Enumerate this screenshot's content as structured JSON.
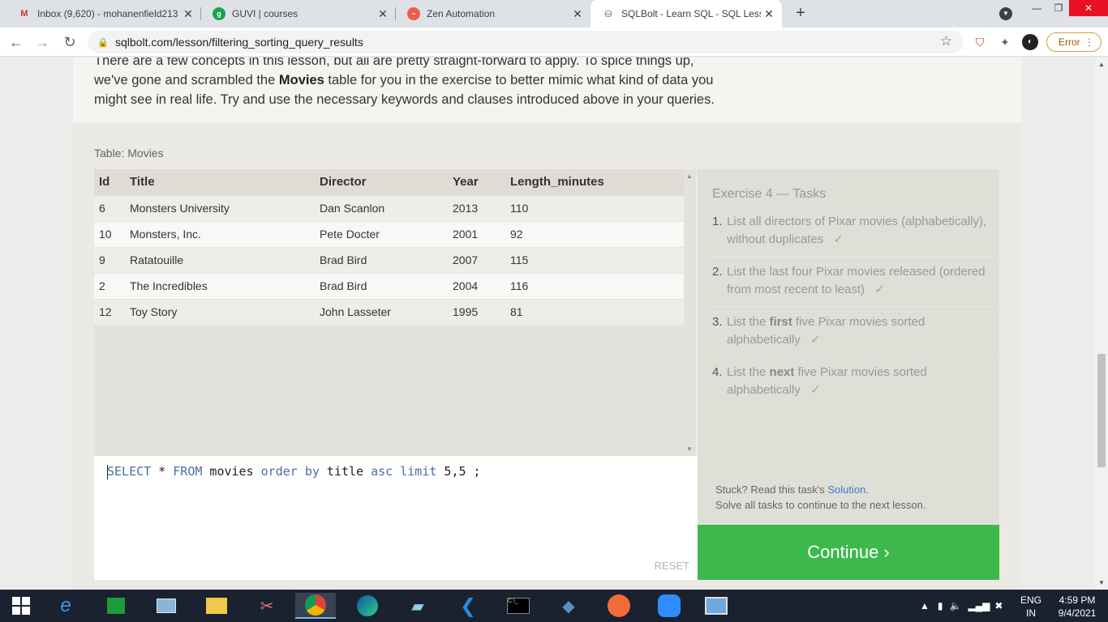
{
  "browser": {
    "tabs": [
      {
        "title": "Inbox (9,620) - mohanenfield213",
        "favicon": "gmail-icon"
      },
      {
        "title": "GUVI | courses",
        "favicon": "guvi-icon"
      },
      {
        "title": "Zen Automation",
        "favicon": "zen-icon"
      },
      {
        "title": "SQLBolt - Learn SQL - SQL Lesso",
        "favicon": "sqlbolt-icon",
        "active": true
      }
    ],
    "url": "sqlbolt.com/lesson/filtering_sorting_query_results",
    "error_label": "Error"
  },
  "lesson": {
    "intro_line1": "There are a few concepts in this lesson, but all are pretty straight-forward to apply. To spice things up,",
    "intro_line2_pre": "we've gone and scrambled the ",
    "intro_line2_bold": "Movies",
    "intro_line2_post": " table for you in the exercise to better mimic what kind of data you",
    "intro_line3": "might see in real life. Try and use the necessary keywords and clauses introduced above in your queries."
  },
  "table": {
    "label": "Table: Movies",
    "columns": [
      "Id",
      "Title",
      "Director",
      "Year",
      "Length_minutes"
    ],
    "rows": [
      [
        "6",
        "Monsters University",
        "Dan Scanlon",
        "2013",
        "110"
      ],
      [
        "10",
        "Monsters, Inc.",
        "Pete Docter",
        "2001",
        "92"
      ],
      [
        "9",
        "Ratatouille",
        "Brad Bird",
        "2007",
        "115"
      ],
      [
        "2",
        "The Incredibles",
        "Brad Bird",
        "2004",
        "116"
      ],
      [
        "12",
        "Toy Story",
        "John Lasseter",
        "1995",
        "81"
      ]
    ]
  },
  "editor": {
    "query_tokens": [
      {
        "t": "SELECT",
        "k": true
      },
      {
        "t": " * ",
        "k": false
      },
      {
        "t": "FROM",
        "k": true
      },
      {
        "t": " movies ",
        "k": false
      },
      {
        "t": "order by",
        "k": true
      },
      {
        "t": " title ",
        "k": false
      },
      {
        "t": "asc",
        "k": true
      },
      {
        "t": " ",
        "k": false
      },
      {
        "t": "limit",
        "k": true
      },
      {
        "t": " 5,5 ;",
        "k": false
      }
    ],
    "reset_label": "RESET"
  },
  "tasks": {
    "heading": "Exercise 4 — Tasks",
    "items": [
      {
        "num": "1.",
        "pre": "List all directors of Pixar movies (alphabetically), without duplicates",
        "bold": "",
        "post": "",
        "done": true
      },
      {
        "num": "2.",
        "pre": "List the last four Pixar movies released (ordered from most recent to least)",
        "bold": "",
        "post": "",
        "done": true
      },
      {
        "num": "3.",
        "pre": "List the ",
        "bold": "first",
        "post": " five Pixar movies sorted alphabetically",
        "done": true
      },
      {
        "num": "4.",
        "pre": "List the ",
        "bold": "next",
        "post": " five Pixar movies sorted alphabetically",
        "done": true
      }
    ],
    "check_mark": "✓",
    "stuck_pre": "Stuck? Read this task's ",
    "stuck_link": "Solution.",
    "stuck_line2": "Solve all tasks to continue to the next lesson.",
    "continue_label": "Continue ›"
  },
  "taskbar": {
    "lang_line1": "ENG",
    "lang_line2": "IN",
    "time": "4:59 PM",
    "date": "9/4/2021"
  }
}
